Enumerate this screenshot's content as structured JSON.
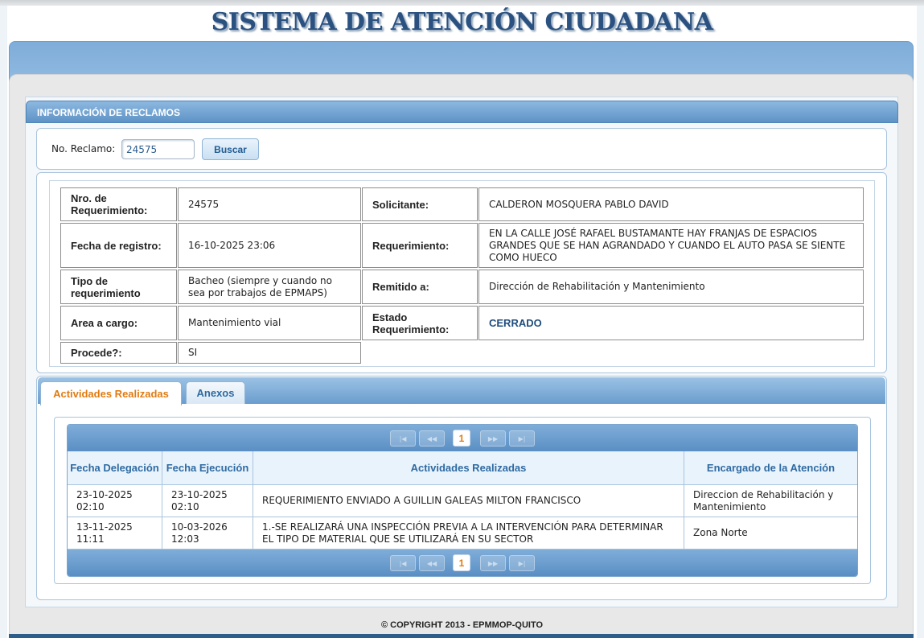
{
  "site": {
    "title": "SISTEMA DE ATENCIÓN CIUDADANA",
    "footer": "© COPYRIGHT 2013 - EPMMOP-QUITO"
  },
  "section": {
    "header": "INFORMACIÓN DE RECLAMOS"
  },
  "search": {
    "label": "No. Reclamo:",
    "value": "24575",
    "button_label": "Buscar"
  },
  "details": {
    "nro_label": "Nro. de Requerimiento:",
    "nro_value": "24575",
    "solicitante_label": "Solicitante:",
    "solicitante_value": "CALDERON MOSQUERA PABLO DAVID",
    "fecha_label": "Fecha de registro:",
    "fecha_value": "16-10-2025 23:06",
    "requerimiento_label": "Requerimiento:",
    "requerimiento_value": "EN LA CALLE JOSÉ RAFAEL BUSTAMANTE HAY FRANJAS DE ESPACIOS GRANDES QUE SE HAN AGRANDADO Y CUANDO EL AUTO PASA SE SIENTE COMO HUECO",
    "tipo_label": "Tipo de requerimiento",
    "tipo_value": "Bacheo (siempre y cuando no sea por trabajos de EPMAPS)",
    "remitido_label": "Remitido a:",
    "remitido_value": "Dirección de Rehabilitación y Mantenimiento",
    "area_label": "Area a cargo:",
    "area_value": "Mantenimiento vial",
    "estado_label": "Estado Requerimiento:",
    "estado_value": "CERRADO",
    "procede_label": "Procede?:",
    "procede_value": "SI"
  },
  "tabs": [
    {
      "label": "Actividades Realizadas",
      "active": true
    },
    {
      "label": "Anexos",
      "active": false
    }
  ],
  "pager": {
    "first_icon": "first-page-icon",
    "prev_icon": "prev-page-icon",
    "next_icon": "next-page-icon",
    "last_icon": "last-page-icon",
    "current_page": "1"
  },
  "activities": {
    "columns": [
      "Fecha Delegación",
      "Fecha Ejecución",
      "Actividades Realizadas",
      "Encargado de la Atención"
    ],
    "rows": [
      {
        "delegacion": "23-10-2025 02:10",
        "ejecucion": "23-10-2025 02:10",
        "actividad": "REQUERIMIENTO ENVIADO A GUILLIN GALEAS MILTON FRANCISCO",
        "encargado": "Direccion de Rehabilitación y Mantenimiento"
      },
      {
        "delegacion": "13-11-2025 11:11",
        "ejecucion": "10-03-2026 12:03",
        "actividad": "1.-SE REALIZARÁ UNA INSPECCIÓN PREVIA A LA INTERVENCIÓN PARA DETERMINAR EL TIPO DE MATERIAL QUE SE UTILIZARÁ EN SU SECTOR",
        "encargado": "Zona Norte"
      }
    ]
  }
}
